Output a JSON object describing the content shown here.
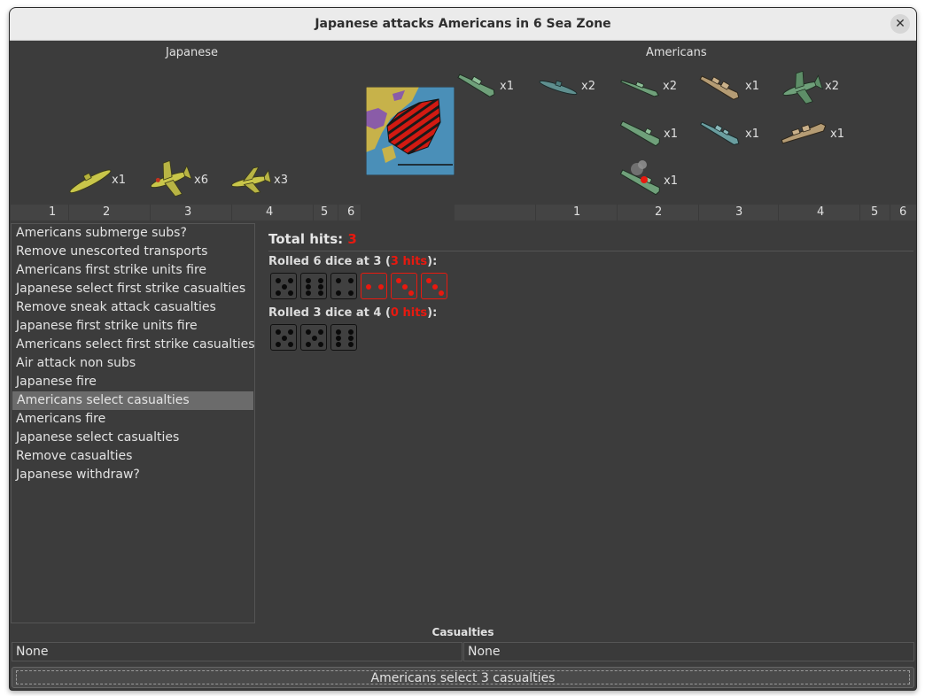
{
  "window": {
    "title": "Japanese attacks Americans in 6 Sea Zone",
    "close_symbol": "✕"
  },
  "attacker": {
    "name": "Japanese",
    "units": [
      {
        "type": "submarine",
        "count": "x1",
        "color": "#c9c64a"
      },
      {
        "type": "fighter",
        "count": "x6",
        "color": "#c9c64a"
      },
      {
        "type": "tactical-bomber",
        "count": "x3",
        "color": "#c9c64a"
      }
    ],
    "die_columns": [
      "1",
      "2",
      "3",
      "4",
      "5",
      "6"
    ]
  },
  "defender": {
    "name": "Americans",
    "units": [
      {
        "type": "transport",
        "count": "x1",
        "color": "#6fa07a"
      },
      {
        "type": "submarine",
        "count": "x2",
        "color": "#5f8f8f"
      },
      {
        "type": "destroyer",
        "count": "x2",
        "color": "#6fa07a"
      },
      {
        "type": "battleship",
        "count": "x1",
        "color": "#b59c74"
      },
      {
        "type": "fighter",
        "count": "x2",
        "color": "#6fa07a"
      },
      {
        "type": "carrier",
        "count": "x1",
        "color": "#6fa07a"
      },
      {
        "type": "cruiser",
        "count": "x1",
        "color": "#6a9ea0"
      },
      {
        "type": "battleship",
        "count": "x1",
        "color": "#b59c74"
      },
      {
        "type": "damaged-carrier",
        "count": "x1",
        "color": "#6fa07a"
      }
    ],
    "die_columns": [
      "1",
      "2",
      "3",
      "4",
      "5",
      "6"
    ]
  },
  "steps": [
    "Americans submerge subs?",
    "Remove unescorted transports",
    "Americans first strike units fire",
    "Japanese select first strike casualties",
    "Remove sneak attack casualties",
    "Japanese first strike units fire",
    "Americans select first strike casualties",
    "Air attack non subs",
    "Japanese fire",
    "Americans select casualties",
    "Americans fire",
    "Japanese select casualties",
    "Remove casualties",
    "Japanese withdraw?"
  ],
  "selected_step": "Americans select casualties",
  "results": {
    "total_label": "Total hits: ",
    "total_hits": "3",
    "rolls": [
      {
        "prefix": "Rolled 6 dice at 3 (",
        "hits": "3 hits",
        "suffix": "):",
        "dice": [
          {
            "value": 5,
            "hit": false
          },
          {
            "value": 6,
            "hit": false
          },
          {
            "value": 4,
            "hit": false
          },
          {
            "value": 2,
            "hit": true
          },
          {
            "value": 3,
            "hit": true
          },
          {
            "value": 3,
            "hit": true
          }
        ]
      },
      {
        "prefix": "Rolled 3 dice at 4 (",
        "hits": "0 hits",
        "suffix": "):",
        "dice": [
          {
            "value": 5,
            "hit": false
          },
          {
            "value": 5,
            "hit": false
          },
          {
            "value": 6,
            "hit": false
          }
        ]
      }
    ]
  },
  "casualties": {
    "header": "Casualties",
    "attacker": "None",
    "defender": "None"
  },
  "action_button": "Americans select 3 casualties",
  "colors": {
    "hit_red": "#e8190f",
    "panel_bg": "#3c3c3c",
    "selected_step_bg": "#6b6b6b"
  }
}
